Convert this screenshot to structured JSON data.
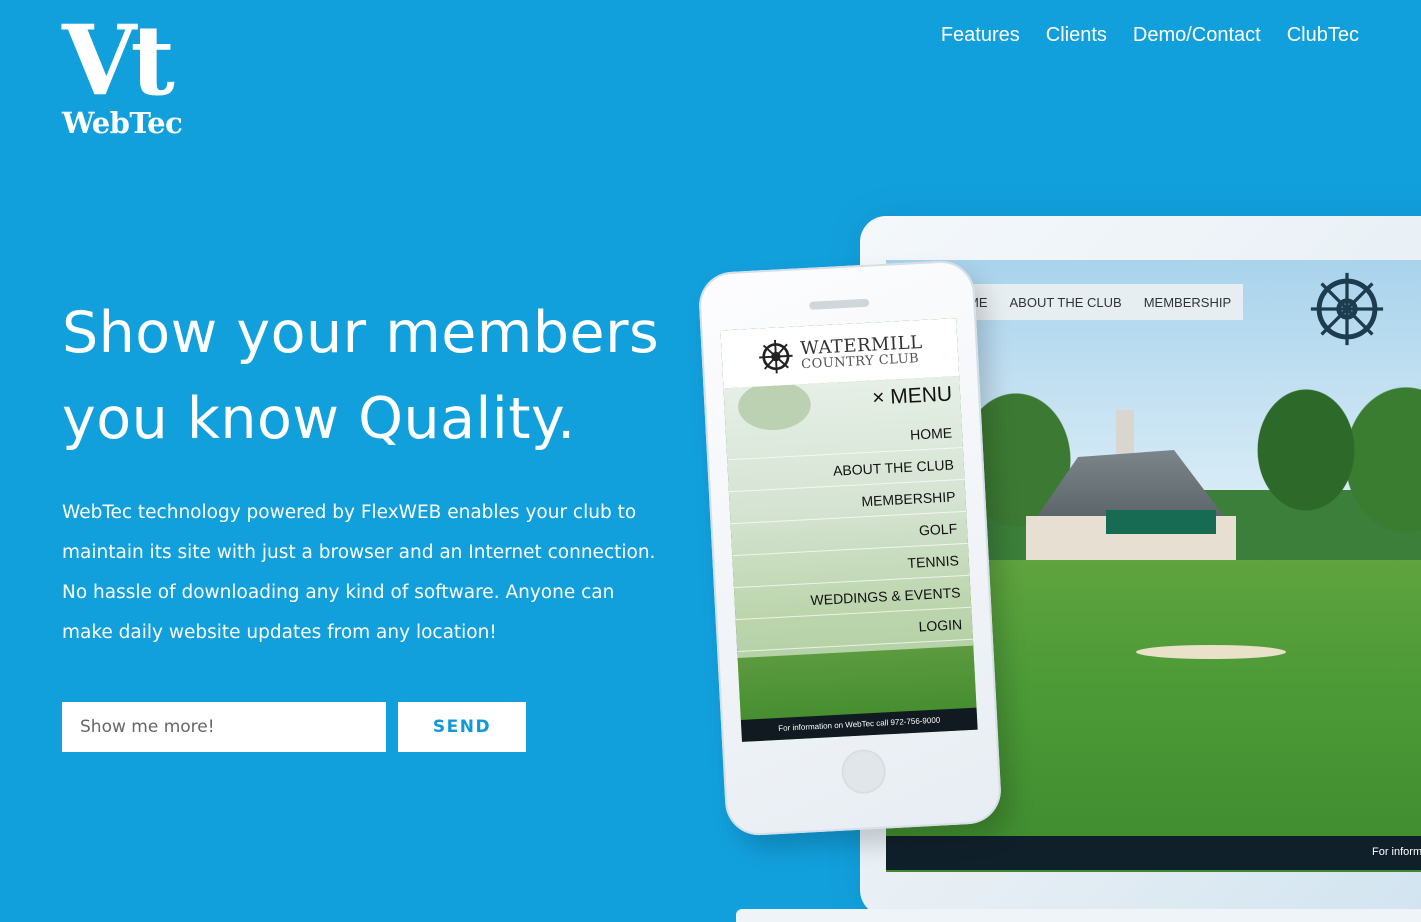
{
  "brand": {
    "logo_mark": "Vt",
    "logo_text": "WebTec"
  },
  "nav": {
    "items": [
      "Features",
      "Clients",
      "Demo/Contact",
      "ClubTec"
    ]
  },
  "hero": {
    "headline_line1": "Show your members",
    "headline_line2": "you know Quality.",
    "intro": "WebTec technology powered by FlexWEB enables your club to maintain its site with just a browser and an Internet connection. No hassle of downloading any kind of software. Anyone can make daily website updates from any location!",
    "form": {
      "input_placeholder": "Show me more!",
      "button_label": "SEND"
    }
  },
  "mockup": {
    "laptop_menu": [
      "ME",
      "ABOUT THE CLUB",
      "MEMBERSHIP"
    ],
    "laptop_footer": "For inform",
    "phone_logo_line1": "WATERMILL",
    "phone_logo_line2": "COUNTRY CLUB",
    "phone_menu_title": "× MENU",
    "phone_menu_items": [
      "HOME",
      "ABOUT THE CLUB",
      "MEMBERSHIP",
      "GOLF",
      "TENNIS",
      "WEDDINGS & EVENTS",
      "LOGIN"
    ],
    "phone_footer": "For information on WebTec call 972-756-9000"
  },
  "colors": {
    "background": "#12a0dd",
    "accent": "#1298d6",
    "text": "#ffffff"
  }
}
